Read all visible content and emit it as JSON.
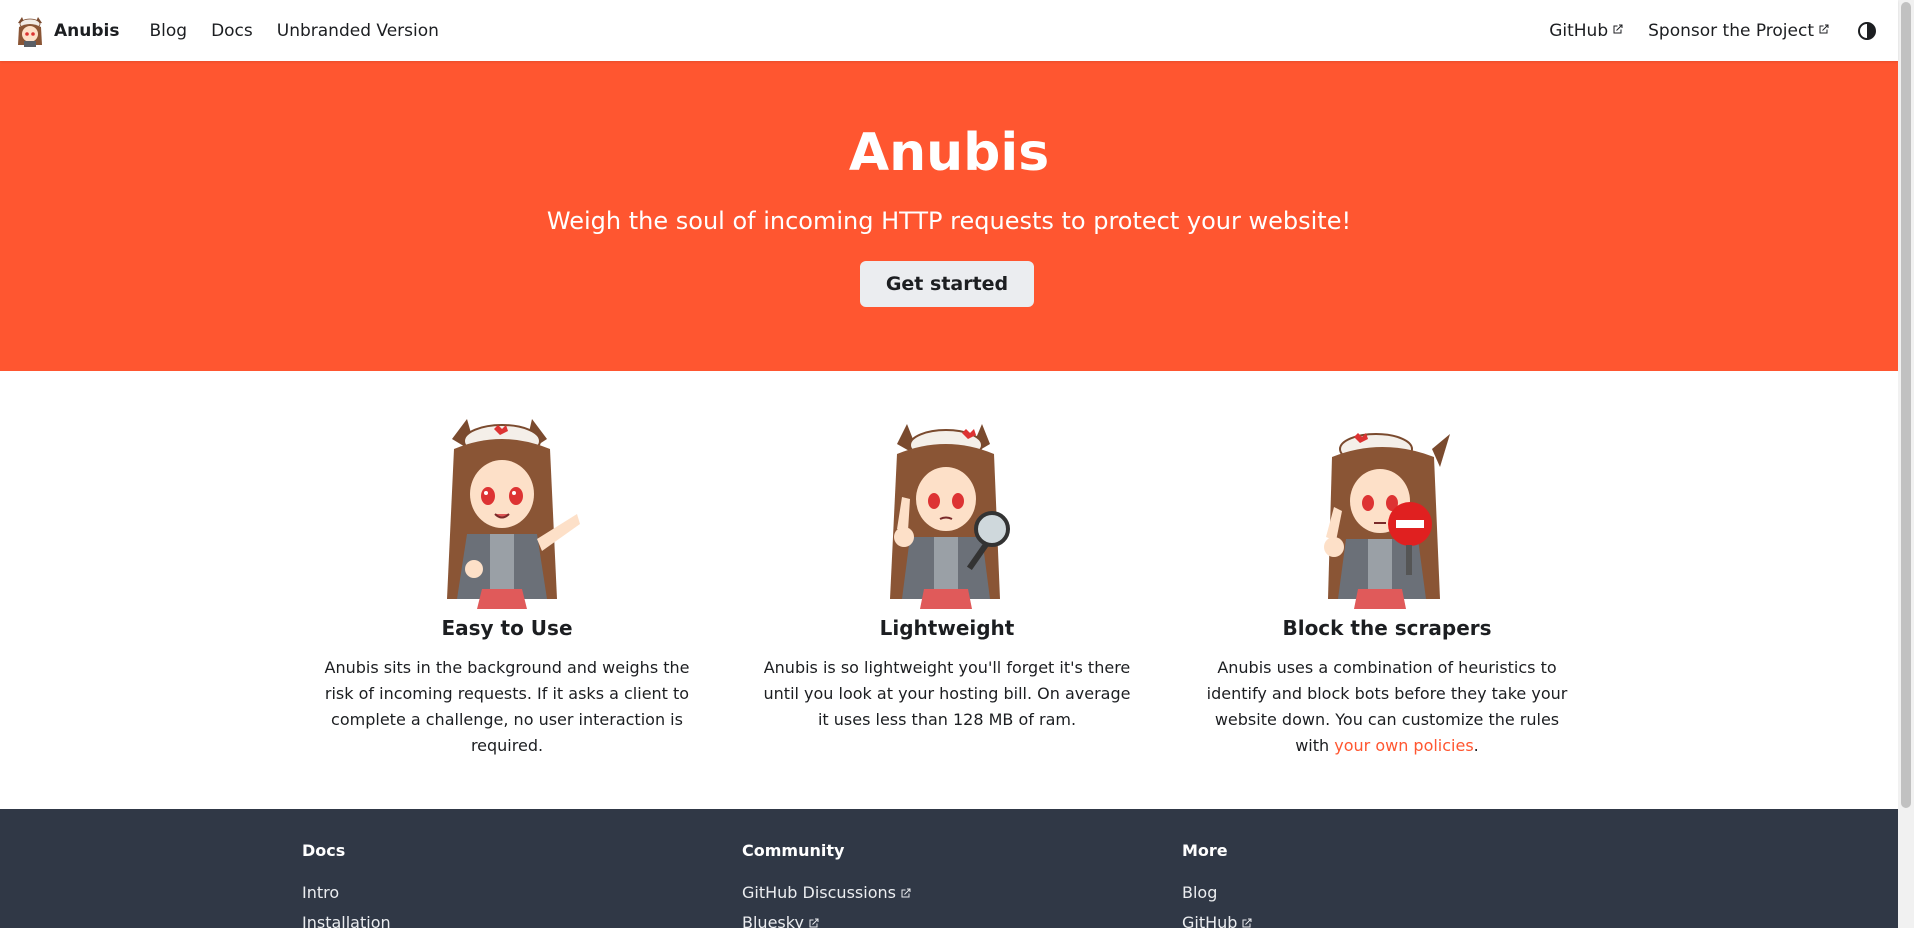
{
  "navbar": {
    "brand_title": "Anubis",
    "links": [
      "Blog",
      "Docs",
      "Unbranded Version"
    ],
    "right_links": [
      "GitHub",
      "Sponsor the Project"
    ],
    "theme_toggle_icon": "half-circle-contrast-icon"
  },
  "hero": {
    "title": "Anubis",
    "subtitle": "Weigh the soul of incoming HTTP requests to protect your website!",
    "cta_label": "Get started",
    "background_color": "#ff5630"
  },
  "features": [
    {
      "title": "Easy to Use",
      "description": "Anubis sits in the background and weighs the risk of incoming requests. If it asks a client to complete a challenge, no user interaction is required."
    },
    {
      "title": "Lightweight",
      "description": "Anubis is so lightweight you'll forget it's there until you look at your hosting bill. On average it uses less than 128 MB of ram."
    },
    {
      "title": "Block the scrapers",
      "description_before": "Anubis uses a combination of heuristics to identify and block bots before they take your website down. You can customize the rules with ",
      "link_text": "your own policies",
      "description_after": "."
    }
  ],
  "footer": {
    "columns": [
      {
        "title": "Docs",
        "items": [
          "Intro",
          "Installation"
        ]
      },
      {
        "title": "Community",
        "items": [
          "GitHub Discussions",
          "Bluesky"
        ]
      },
      {
        "title": "More",
        "items": [
          "Blog",
          "GitHub"
        ]
      }
    ],
    "background_color": "#303846"
  },
  "colors": {
    "accent": "#ff5630",
    "footer_bg": "#303846",
    "button_bg": "#ebedf0"
  }
}
